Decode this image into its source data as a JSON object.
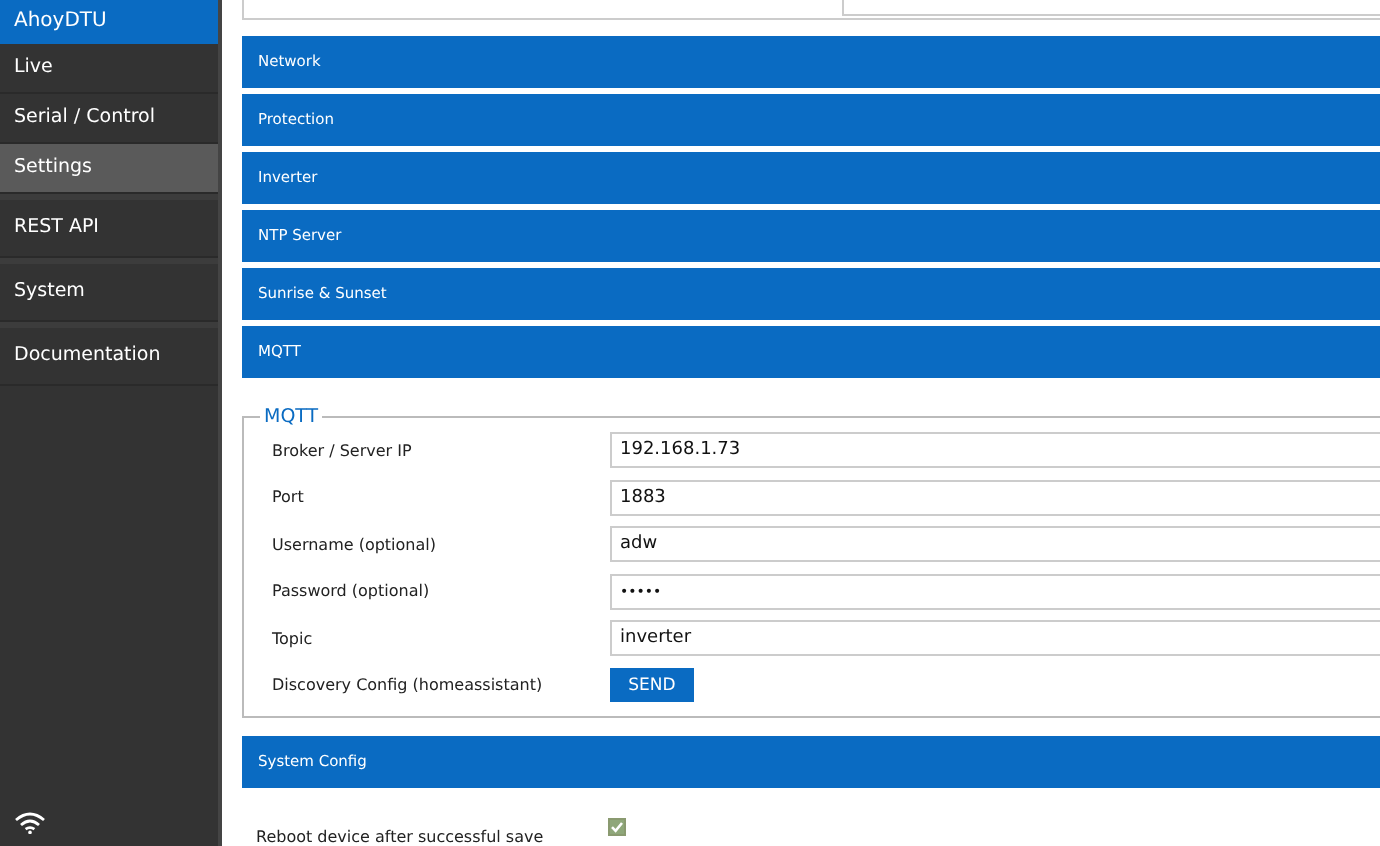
{
  "sidebar": {
    "title": "AhoyDTU",
    "groups": [
      [
        {
          "label": "Live",
          "selected": false
        },
        {
          "label": "Serial / Control",
          "selected": false
        },
        {
          "label": "Settings",
          "selected": true
        }
      ],
      [
        {
          "label": "REST API",
          "selected": false
        }
      ],
      [
        {
          "label": "System",
          "selected": false
        }
      ],
      [
        {
          "label": "Documentation",
          "selected": false
        }
      ]
    ]
  },
  "sections": [
    {
      "title": "Network"
    },
    {
      "title": "Protection"
    },
    {
      "title": "Inverter"
    },
    {
      "title": "NTP Server"
    },
    {
      "title": "Sunrise & Sunset"
    },
    {
      "title": "MQTT"
    }
  ],
  "mqtt": {
    "legend": "MQTT",
    "fields": [
      {
        "kind": "text",
        "label": "Broker / Server IP",
        "value": "192.168.1.73"
      },
      {
        "kind": "text",
        "label": "Port",
        "value": "1883"
      },
      {
        "kind": "text",
        "label": "Username (optional)",
        "value": "adw"
      },
      {
        "kind": "password",
        "label": "Password (optional)",
        "value": "•••••"
      },
      {
        "kind": "text",
        "label": "Topic",
        "value": "inverter"
      },
      {
        "kind": "button",
        "label": "Discovery Config (homeassistant)",
        "value": "SEND"
      }
    ]
  },
  "system_config": {
    "title": "System Config",
    "reboot": {
      "label": "Reboot device after successful save",
      "checked": true
    }
  }
}
